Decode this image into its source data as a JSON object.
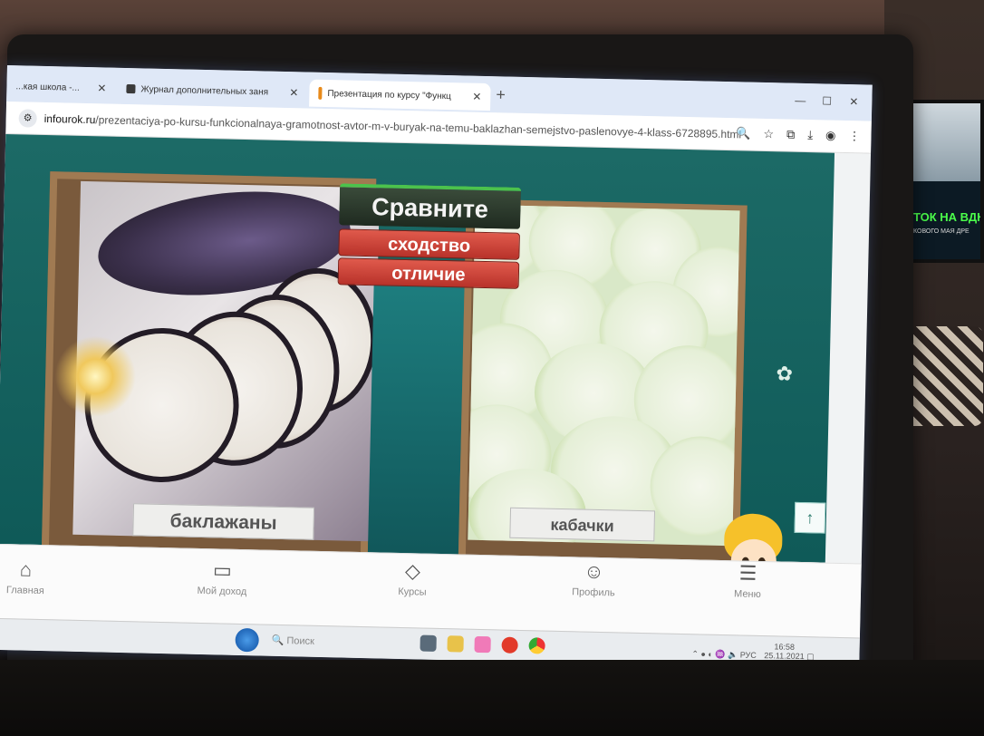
{
  "browser": {
    "tabs": [
      {
        "label": "...кая школа -...",
        "active": false
      },
      {
        "label": "Журнал дополнительных заня",
        "active": false
      },
      {
        "label": "Презентация по курсу \"Функц",
        "active": true
      }
    ],
    "new_tab_label": "+",
    "url_host": "infourok.ru",
    "url_path": "/prezentaciya-po-kursu-funkcionalnaya-gramotnost-avtor-m-v-buryak-na-temu-baklazhan-semejstvo-paslenovye-4-klass-6728895.html"
  },
  "slide": {
    "title_button": "Сравните",
    "similarity_button": "сходство",
    "difference_button": "отличие",
    "left_label": "баклажаны",
    "right_label": "кабачки"
  },
  "bottom_nav": {
    "home": "Главная",
    "income": "Мой доход",
    "courses": "Курсы",
    "profile": "Профиль",
    "menu": "Меню"
  },
  "taskbar": {
    "search_placeholder": "Поиск",
    "language": "РУС",
    "time": "16:58",
    "date": "25.11.2021"
  },
  "second_monitor": {
    "ticker": "ТОК НА ВДН",
    "subticker": "КОВОГО МАЯ ДРЕ"
  },
  "colors": {
    "slide_teal": "#0f5a58",
    "button_red": "#c8402f",
    "title_green": "#4cc24c"
  }
}
